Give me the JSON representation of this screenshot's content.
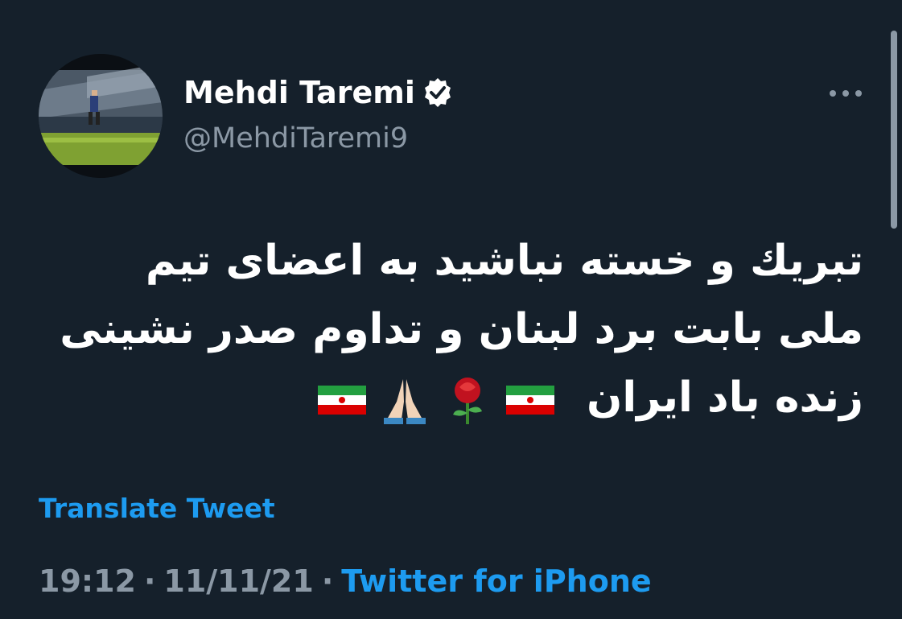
{
  "tweet": {
    "author": {
      "display_name": "Mehdi Taremi",
      "handle": "@MehdiTaremi9",
      "verified": true,
      "avatar": "avatar-photo-football-pitch"
    },
    "text_lines": [
      "تبريك و خسته نباشيد به اعضای تیم",
      "ملی بابت برد لبنان و تداوم صدر نشینی",
      "زنده باد ایران"
    ],
    "emojis": [
      "iran-flag-emoji",
      "rose-emoji",
      "folded-hands-emoji",
      "iran-flag-emoji"
    ],
    "translate_label": "Translate Tweet",
    "time": "19:12",
    "date": "11/11/21",
    "separator": "·",
    "source": "Twitter for iPhone"
  },
  "colors": {
    "background": "#15202b",
    "text_primary": "#ffffff",
    "text_secondary": "#8b98a5",
    "accent": "#1d9bf0"
  },
  "icons": {
    "verified": "verified-badge-icon",
    "more": "more-options-icon"
  }
}
